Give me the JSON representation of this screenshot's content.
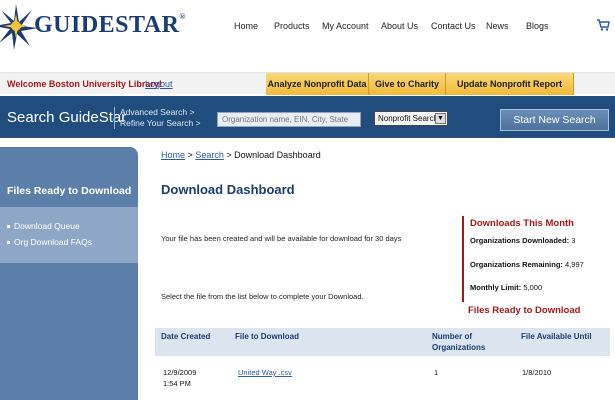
{
  "header": {
    "logo_text": "GUIDESTAR",
    "nav": [
      "Home",
      "Products",
      "My Account",
      "About Us",
      "Contact Us",
      "News",
      "Blogs"
    ]
  },
  "welcome_bar": {
    "welcome": "Welcome Boston University Library!",
    "logout": "Logout",
    "tabs": [
      "Analyze Nonprofit Data",
      "Give to Charity",
      "Update Nonprofit Report"
    ]
  },
  "search": {
    "title": "Search GuideStar",
    "advanced": "Advanced Search >",
    "refine": "Refine Your Search >",
    "placeholder": "Organization name, EIN, City, State",
    "select_value": "Nonprofit Search",
    "start_button": "Start New Search"
  },
  "sidebar": {
    "title": "Files Ready to Download",
    "items": [
      "Download Queue",
      "Org Download FAQs"
    ]
  },
  "breadcrumb": {
    "home": "Home",
    "search": "Search",
    "current": "Download Dashboard",
    "sep": ">"
  },
  "main": {
    "title": "Download Dashboard",
    "message": "Your file has been created and will be available for download for 30 days",
    "instruction": "Select the file from the list below to complete your Download."
  },
  "stats": {
    "title": "Downloads This Month",
    "downloaded_label": "Organizations Downloaded:",
    "downloaded_value": "3",
    "remaining_label": "Organizations Remaining:",
    "remaining_value": "4,997",
    "limit_label": "Monthly Limit:",
    "limit_value": "5,000"
  },
  "files_ready_title": "Files Ready to Download",
  "table": {
    "headers": [
      "Date Created",
      "File to Download",
      "Number of",
      "Organizations",
      "File Available Until"
    ],
    "rows": [
      {
        "date": "12/9/2009",
        "time": "1:54 PM",
        "file": "United Way .csv",
        "count": "1",
        "until": "1/8/2010"
      }
    ]
  },
  "colors": {
    "brand_blue": "#204d7d",
    "accent_red": "#a31919",
    "tab_yellow": "#f0b93a",
    "sidebar_blue": "#5b7fa8"
  }
}
